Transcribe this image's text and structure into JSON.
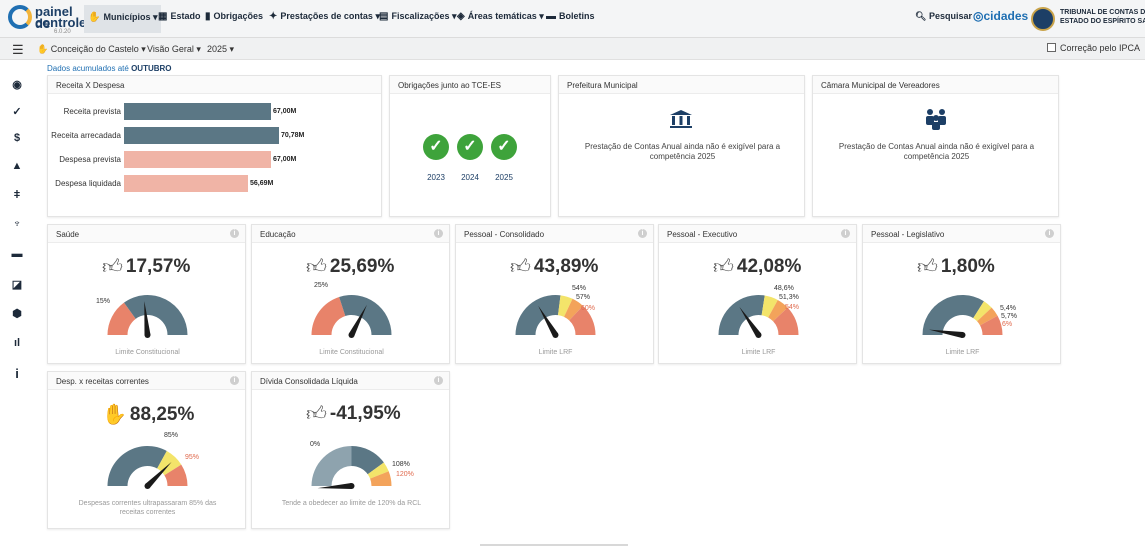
{
  "logo": {
    "line1": "painel de",
    "line2": "controle",
    "version": "6.0.20"
  },
  "nav": [
    {
      "label": "Municípios",
      "icon": "hand-icon",
      "dropdown": true,
      "active": true
    },
    {
      "label": "Estado",
      "icon": "grid-icon",
      "dropdown": false
    },
    {
      "label": "Obrigações",
      "icon": "bank-icon",
      "dropdown": false
    },
    {
      "label": "Prestações de contas",
      "icon": "users-icon",
      "dropdown": true
    },
    {
      "label": "Fiscalizações",
      "icon": "doc-icon",
      "dropdown": true
    },
    {
      "label": "Áreas temáticas",
      "icon": "cube-icon",
      "dropdown": true
    },
    {
      "label": "Boletins",
      "icon": "newspaper-icon",
      "dropdown": false
    }
  ],
  "search": {
    "label": "Pesquisar"
  },
  "cidades": {
    "label": "cidades"
  },
  "tce": {
    "line1": "TRIBUNAL DE CONTAS DO",
    "line2": "ESTADO DO ESPÍRITO SANTO"
  },
  "subbar": {
    "municipio": "Conceição do Castelo",
    "visao": "Visão Geral",
    "ano": "2025",
    "ipca_label": "Correção pelo IPCA"
  },
  "accumulated": {
    "prefix": "Dados acumulados até",
    "month": "OUTUBRO"
  },
  "receita_card": {
    "title": "Receita X Despesa",
    "rows": [
      {
        "label": "Receita prevista",
        "value": 67.0,
        "display": "67,00M",
        "color": "#5b7785"
      },
      {
        "label": "Receita arrecadada",
        "value": 70.78,
        "display": "70,78M",
        "color": "#5b7785"
      },
      {
        "label": "Despesa prevista",
        "value": 67.0,
        "display": "67,00M",
        "color": "#f0b4a6"
      },
      {
        "label": "Despesa liquidada",
        "value": 56.69,
        "display": "56,69M",
        "color": "#f0b4a6"
      }
    ]
  },
  "obrigacoes_card": {
    "title": "Obrigações junto ao TCE-ES",
    "years": [
      "2023",
      "2024",
      "2025"
    ]
  },
  "prefeitura_card": {
    "title": "Prefeitura Municipal",
    "text": "Prestação de Contas Anual ainda não é exigível para a competência 2025"
  },
  "camara_card": {
    "title": "Câmara Municipal de Vereadores",
    "text": "Prestação de Contas Anual ainda não é exigível para a competência 2025"
  },
  "gauges": [
    {
      "title": "Saúde",
      "value_display": "17,57%",
      "indicator": "thumbs-up",
      "value": 17.57,
      "thresholds": [
        15
      ],
      "labels": [
        "15%"
      ],
      "footer": "Limite Constitucional"
    },
    {
      "title": "Educação",
      "value_display": "25,69%",
      "indicator": "thumbs-up",
      "value": 25.69,
      "thresholds": [
        25
      ],
      "labels": [
        "25%"
      ],
      "footer": "Limite Constitucional"
    },
    {
      "title": "Pessoal - Consolidado",
      "value_display": "43,89%",
      "indicator": "thumbs-up",
      "value": 43.89,
      "thresholds": [
        54,
        57,
        60
      ],
      "labels": [
        "54%",
        "57%",
        "60%"
      ],
      "footer": "Limite LRF"
    },
    {
      "title": "Pessoal - Executivo",
      "value_display": "42,08%",
      "indicator": "thumbs-up",
      "value": 42.08,
      "thresholds": [
        48.6,
        51.3,
        54
      ],
      "labels": [
        "48,6%",
        "51,3%",
        "54%"
      ],
      "footer": "Limite LRF"
    },
    {
      "title": "Pessoal - Legislativo",
      "value_display": "1,80%",
      "indicator": "thumbs-up",
      "value": 1.8,
      "thresholds": [
        5.4,
        5.7,
        6
      ],
      "labels": [
        "5,4%",
        "5,7%",
        "6%"
      ],
      "footer": "Limite LRF"
    },
    {
      "title": "Desp. x receitas correntes",
      "value_display": "88,25%",
      "indicator": "hand",
      "value": 88.25,
      "thresholds": [
        85,
        95
      ],
      "labels": [
        "85%",
        "95%"
      ],
      "footer": "Despesas correntes ultrapassaram 85% das receitas correntes"
    },
    {
      "title": "Dívida Consolidada Líquida",
      "value_display": "-41,95%",
      "indicator": "thumbs-up",
      "value": -41.95,
      "thresholds": [
        0,
        108,
        120
      ],
      "labels": [
        "0%",
        "108%",
        "120%"
      ],
      "footer": "Tende a obedecer ao limite de 120% da RCL"
    }
  ],
  "colors": {
    "slate": "#5b7785",
    "salmon": "#e8836a",
    "yellow": "#f3e46a",
    "orange": "#f3a35b",
    "green": "#3ea33b",
    "brand": "#1f6fb2"
  }
}
